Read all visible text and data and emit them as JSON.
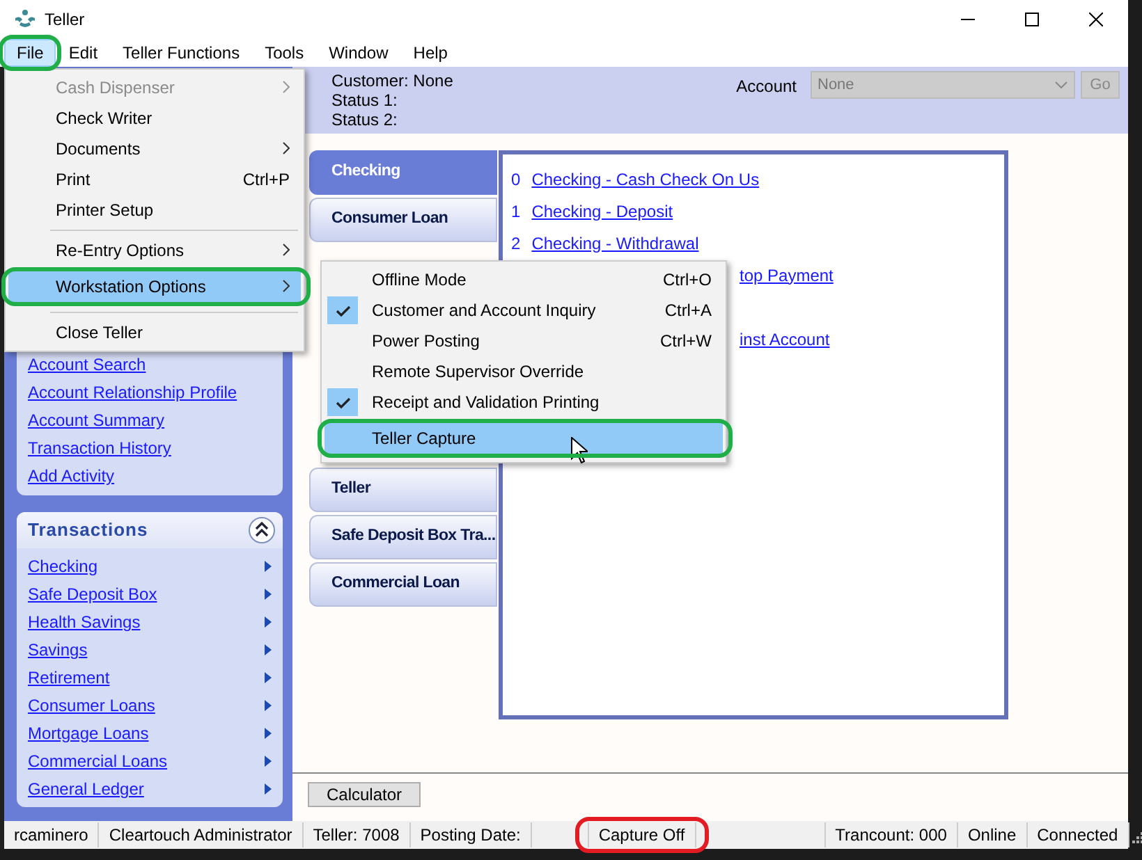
{
  "window": {
    "title": "Teller"
  },
  "menu_bar": [
    {
      "label": "File",
      "selected": true,
      "color": "#1fae48"
    },
    {
      "label": "Edit",
      "selected": false
    },
    {
      "label": "Teller Functions",
      "selected": false
    },
    {
      "label": "Tools",
      "selected": false
    },
    {
      "label": "Window",
      "selected": false
    },
    {
      "label": "Help",
      "selected": false
    }
  ],
  "file_menu": [
    {
      "kind": "item",
      "label": "Cash Dispenser",
      "disabled": true,
      "submenu": true,
      "selected": false
    },
    {
      "kind": "item",
      "label": "Check Writer",
      "disabled": false,
      "submenu": false,
      "selected": false
    },
    {
      "kind": "item",
      "label": "Documents",
      "disabled": false,
      "submenu": true,
      "selected": false
    },
    {
      "kind": "item",
      "label": "Print",
      "shortcut": "Ctrl+P",
      "disabled": false,
      "submenu": false,
      "selected": false
    },
    {
      "kind": "item",
      "label": "Printer Setup",
      "disabled": false,
      "submenu": false,
      "selected": false
    },
    {
      "kind": "separator"
    },
    {
      "kind": "item",
      "label": "Re-Entry Options",
      "disabled": false,
      "submenu": true,
      "selected": false
    },
    {
      "kind": "item",
      "label": "Workstation Options",
      "disabled": false,
      "submenu": true,
      "selected": true,
      "color": "#1fae48"
    },
    {
      "kind": "separator"
    },
    {
      "kind": "item",
      "label": "Close Teller",
      "disabled": false,
      "submenu": false,
      "selected": false
    }
  ],
  "workstation_submenu": [
    {
      "label": "Offline Mode",
      "shortcut": "Ctrl+O",
      "checked": false,
      "selected": false
    },
    {
      "label": "Customer and Account Inquiry",
      "shortcut": "Ctrl+A",
      "checked": true,
      "selected": false
    },
    {
      "label": "Power Posting",
      "shortcut": "Ctrl+W",
      "checked": false,
      "selected": false
    },
    {
      "label": "Remote Supervisor Override",
      "checked": false,
      "selected": false
    },
    {
      "label": "Receipt and Validation Printing",
      "checked": true,
      "selected": false
    },
    {
      "label": "Teller Capture",
      "checked": false,
      "selected": true,
      "color": "#1fae48"
    }
  ],
  "header": {
    "customer": "Customer: None",
    "status_1": "Status 1:",
    "status_2": "Status 2:",
    "account_label": "Account",
    "account_value": "None",
    "go_button": "Go"
  },
  "sidebar": {
    "links": [
      "Account Search",
      "Account Relationship Profile",
      "Account Summary",
      "Transaction History",
      "Add Activity"
    ],
    "transactions": {
      "title": "Transactions",
      "expanded": true,
      "items": [
        "Checking",
        "Safe Deposit Box",
        "Health Savings",
        "Savings",
        "Retirement",
        "Consumer Loans",
        "Mortgage Loans",
        "Commercial Loans",
        "General Ledger"
      ]
    }
  },
  "tabs": [
    {
      "label": "Checking",
      "selected": true
    },
    {
      "label": "Consumer Loan",
      "selected": false
    },
    {
      "label": "Teller",
      "selected": false
    },
    {
      "label": "Safe Deposit Box Tra...",
      "selected": false
    },
    {
      "label": "Commercial Loan",
      "selected": false
    }
  ],
  "transaction_list": [
    {
      "kind": "full",
      "number": "0",
      "label": "Checking - Cash Check On Us"
    },
    {
      "kind": "full",
      "number": "1",
      "label": "Checking - Deposit"
    },
    {
      "kind": "full",
      "number": "2",
      "label": "Checking - Withdrawal"
    },
    {
      "kind": "partial",
      "label": "top Payment"
    },
    {
      "kind": "partial",
      "label": "inst Account"
    }
  ],
  "calculator_button": "Calculator",
  "status_bar": [
    {
      "text": "rcaminero"
    },
    {
      "text": "Cleartouch Administrator"
    },
    {
      "text": "Teller: 7008"
    },
    {
      "text": "Posting Date:"
    },
    {
      "text": "Capture Off",
      "color": "#e31b23"
    },
    {
      "text": "Trancount: 000"
    },
    {
      "text": "Online"
    },
    {
      "text": "Connected"
    }
  ]
}
